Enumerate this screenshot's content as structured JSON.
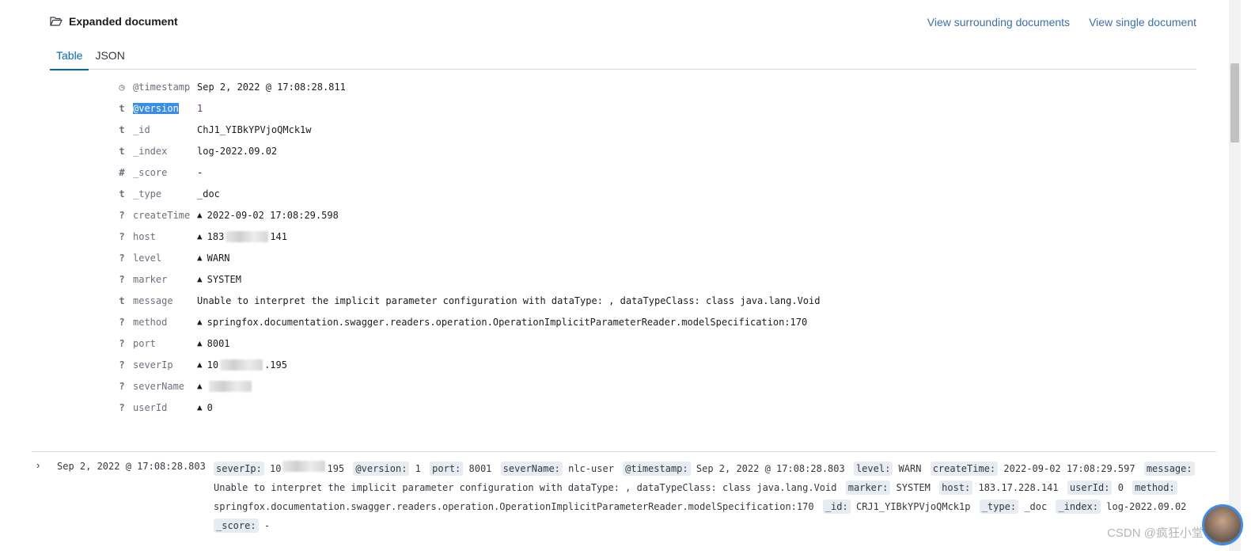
{
  "header": {
    "title": "Expanded document",
    "icon": "folder-open-icon",
    "links": [
      "View surrounding documents",
      "View single document"
    ]
  },
  "tabs": [
    {
      "label": "Table",
      "active": true
    },
    {
      "label": "JSON",
      "active": false
    }
  ],
  "fields": [
    {
      "type": "clock",
      "name": "@timestamp",
      "value": "Sep 2, 2022 @ 17:08:28.811"
    },
    {
      "type": "t",
      "name": "@version",
      "value": "1",
      "selected": true
    },
    {
      "type": "t",
      "name": "_id",
      "value": "ChJ1_YIBkYPVjoQMck1w"
    },
    {
      "type": "t",
      "name": "_index",
      "value": "log-2022.09.02"
    },
    {
      "type": "#",
      "name": "_score",
      "value": " -"
    },
    {
      "type": "t",
      "name": "_type",
      "value": "_doc"
    },
    {
      "type": "?",
      "name": "createTime",
      "warn": true,
      "value": "2022-09-02 17:08:29.598"
    },
    {
      "type": "?",
      "name": "host",
      "warn": true,
      "value": "183",
      "blurred": true,
      "suffix": "141"
    },
    {
      "type": "?",
      "name": "level",
      "warn": true,
      "value": "WARN"
    },
    {
      "type": "?",
      "name": "marker",
      "warn": true,
      "value": "SYSTEM"
    },
    {
      "type": "t",
      "name": "message",
      "value": "Unable to interpret the implicit parameter configuration with dataType: , dataTypeClass: class java.lang.Void"
    },
    {
      "type": "?",
      "name": "method",
      "warn": true,
      "value": "springfox.documentation.swagger.readers.operation.OperationImplicitParameterReader.modelSpecification:170"
    },
    {
      "type": "?",
      "name": "port",
      "warn": true,
      "value": "8001"
    },
    {
      "type": "?",
      "name": "severIp",
      "warn": true,
      "value": "10",
      "blurred": true,
      "suffix": ".195"
    },
    {
      "type": "?",
      "name": "severName",
      "warn": true,
      "value": "",
      "blurred": true,
      "suffix": ""
    },
    {
      "type": "?",
      "name": "userId",
      "warn": true,
      "value": "0"
    }
  ],
  "next_doc": {
    "timestamp": "Sep 2, 2022 @ 17:08:28.803",
    "pairs": [
      {
        "k": "severIp:",
        "v": "10",
        "blurred": true,
        "suffix": "195"
      },
      {
        "k": "@version:",
        "v": "1"
      },
      {
        "k": "port:",
        "v": "8001"
      },
      {
        "k": "severName:",
        "v": "nlc-user"
      },
      {
        "k": "@timestamp:",
        "v": "Sep 2, 2022 @ 17:08:28.803"
      },
      {
        "k": "level:",
        "v": "WARN"
      },
      {
        "k": "createTime:",
        "v": "2022-09-02 17:08:29.597"
      },
      {
        "k": "message:",
        "v": "Unable to interpret the implicit parameter configuration with dataType: , dataTypeClass: class java.lang.Void"
      },
      {
        "k": "marker:",
        "v": "SYSTEM"
      },
      {
        "k": "host:",
        "v": "183.17.228.141"
      },
      {
        "k": "userId:",
        "v": "0"
      },
      {
        "k": "method:",
        "v": "springfox.documentation.swagger.readers.operation.OperationImplicitParameterReader.modelSpecification:170"
      },
      {
        "k": "_id:",
        "v": "CRJ1_YIBkYPVjoQMck1p"
      },
      {
        "k": "_type:",
        "v": "_doc"
      },
      {
        "k": "_index:",
        "v": "log-2022.09.02"
      },
      {
        "k": "_score:",
        "v": " -"
      }
    ]
  },
  "watermark": "CSDN @疯狂小堂"
}
